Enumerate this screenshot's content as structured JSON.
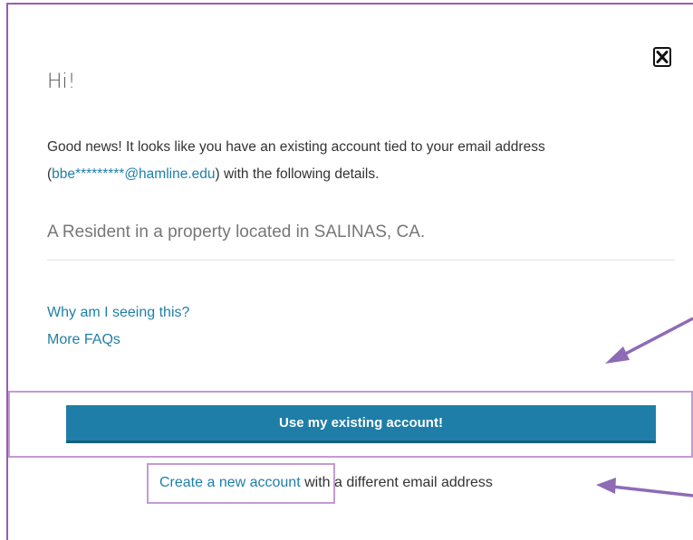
{
  "dialog": {
    "greeting": "Hi!",
    "intro_before": "Good news! It looks like you have an existing account tied to your email address (",
    "email": "bbe*********@hamline.edu",
    "intro_after": ") with the following details.",
    "detail": "A Resident in a property located in SALINAS, CA.",
    "faq_link_1": "Why am I seeing this?",
    "faq_link_2": "More FAQs",
    "primary_button": "Use my existing account!",
    "create_link": "Create a new account",
    "create_suffix": " with a different email address",
    "close_icon": "close-icon"
  },
  "colors": {
    "accent": "#1e7ea7",
    "link": "#1f7fa8",
    "annotation": "#9b59b6",
    "highlight": "#c39bd3"
  }
}
